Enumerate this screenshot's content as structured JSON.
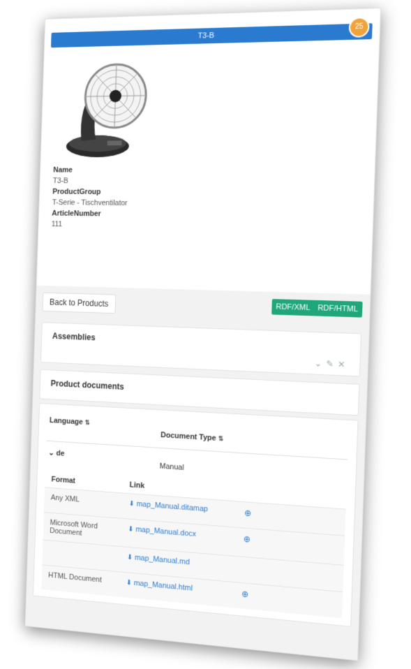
{
  "header": {
    "title": "T3-B",
    "badge_count": "25"
  },
  "product": {
    "name_label": "Name",
    "name_value": "T3-B",
    "group_label": "ProductGroup",
    "group_value": "T-Serie - Tischventilator",
    "article_label": "ArticleNumber",
    "article_value": "111",
    "image_icon": "desk-fan-image"
  },
  "actions": {
    "back": "Back to Products",
    "rdf_xml": "RDF/XML",
    "rdf_html": "RDF/HTML"
  },
  "assemblies": {
    "title": "Assemblies",
    "tool_icons": [
      "chevron-down-icon",
      "wrench-icon",
      "close-icon"
    ]
  },
  "documents": {
    "title": "Product documents",
    "col_language": "Language",
    "col_doc_type": "Document Type",
    "group": {
      "language": "de",
      "doc_type": "Manual"
    },
    "sub_col_format": "Format",
    "sub_col_link": "Link",
    "rows": [
      {
        "format": "Any XML",
        "link": "map_Manual.ditamap"
      },
      {
        "format": "Microsoft Word Document",
        "link": "map_Manual.docx"
      },
      {
        "format": "",
        "link": "map_Manual.md"
      },
      {
        "format": "HTML Document",
        "link": "map_Manual.html"
      }
    ]
  },
  "colors": {
    "accent": "#2a7bd0",
    "badge": "#f0a33b",
    "rdf": "#1fa67a"
  }
}
